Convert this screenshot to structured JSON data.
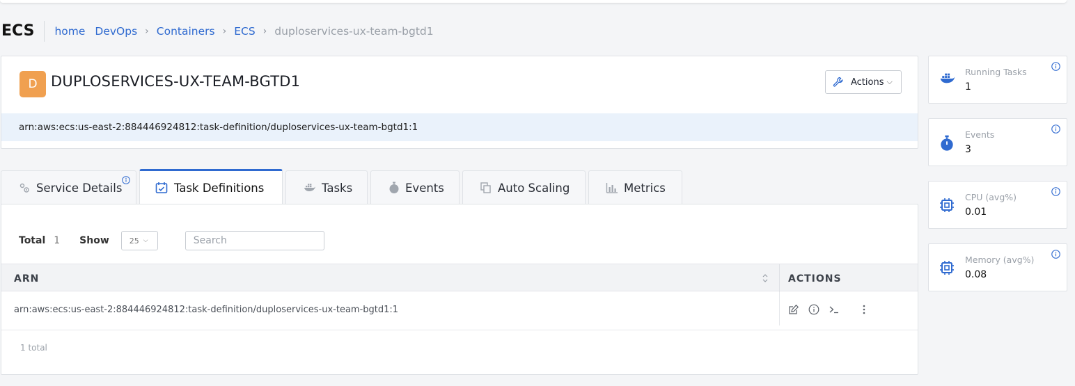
{
  "header": {
    "page_title": "ECS",
    "breadcrumbs": [
      {
        "label": "home"
      },
      {
        "label": "DevOps"
      },
      {
        "label": "Containers"
      },
      {
        "label": "ECS"
      },
      {
        "label": "duploservices-ux-team-bgtd1"
      }
    ]
  },
  "service": {
    "avatar_letter": "D",
    "name": "DUPLOSERVICES-UX-TEAM-BGTD1",
    "arn": "arn:aws:ecs:us-east-2:884446924812:task-definition/duploservices-ux-team-bgtd1:1",
    "actions_label": "Actions"
  },
  "tabs": [
    {
      "label": "Service Details",
      "icon": "gears-icon",
      "active": false
    },
    {
      "label": "Task Definitions",
      "icon": "calendar-check-icon",
      "active": true
    },
    {
      "label": "Tasks",
      "icon": "docker-icon",
      "active": false
    },
    {
      "label": "Events",
      "icon": "stopwatch-icon",
      "active": false
    },
    {
      "label": "Auto Scaling",
      "icon": "copy-icon",
      "active": false
    },
    {
      "label": "Metrics",
      "icon": "bar-chart-icon",
      "active": false
    }
  ],
  "toolbar": {
    "total_label": "Total",
    "total_value": "1",
    "show_label": "Show",
    "page_size": "25",
    "search_placeholder": "Search"
  },
  "table": {
    "columns": [
      "ARN",
      "ACTIONS"
    ],
    "rows": [
      {
        "arn": "arn:aws:ecs:us-east-2:884446924812:task-definition/duploservices-ux-team-bgtd1:1"
      }
    ],
    "footer": "1 total"
  },
  "stats": [
    {
      "label": "Running Tasks",
      "value": "1",
      "icon": "docker-icon"
    },
    {
      "label": "Events",
      "value": "3",
      "icon": "stopwatch-icon"
    },
    {
      "label": "CPU (avg%)",
      "value": "0.01",
      "icon": "cpu-chip-icon"
    },
    {
      "label": "Memory (avg%)",
      "value": "0.08",
      "icon": "cpu-chip-icon"
    }
  ],
  "colors": {
    "accent": "#2f6ad0",
    "avatar": "#f0a050",
    "arn_strip": "#eaf2fb"
  }
}
